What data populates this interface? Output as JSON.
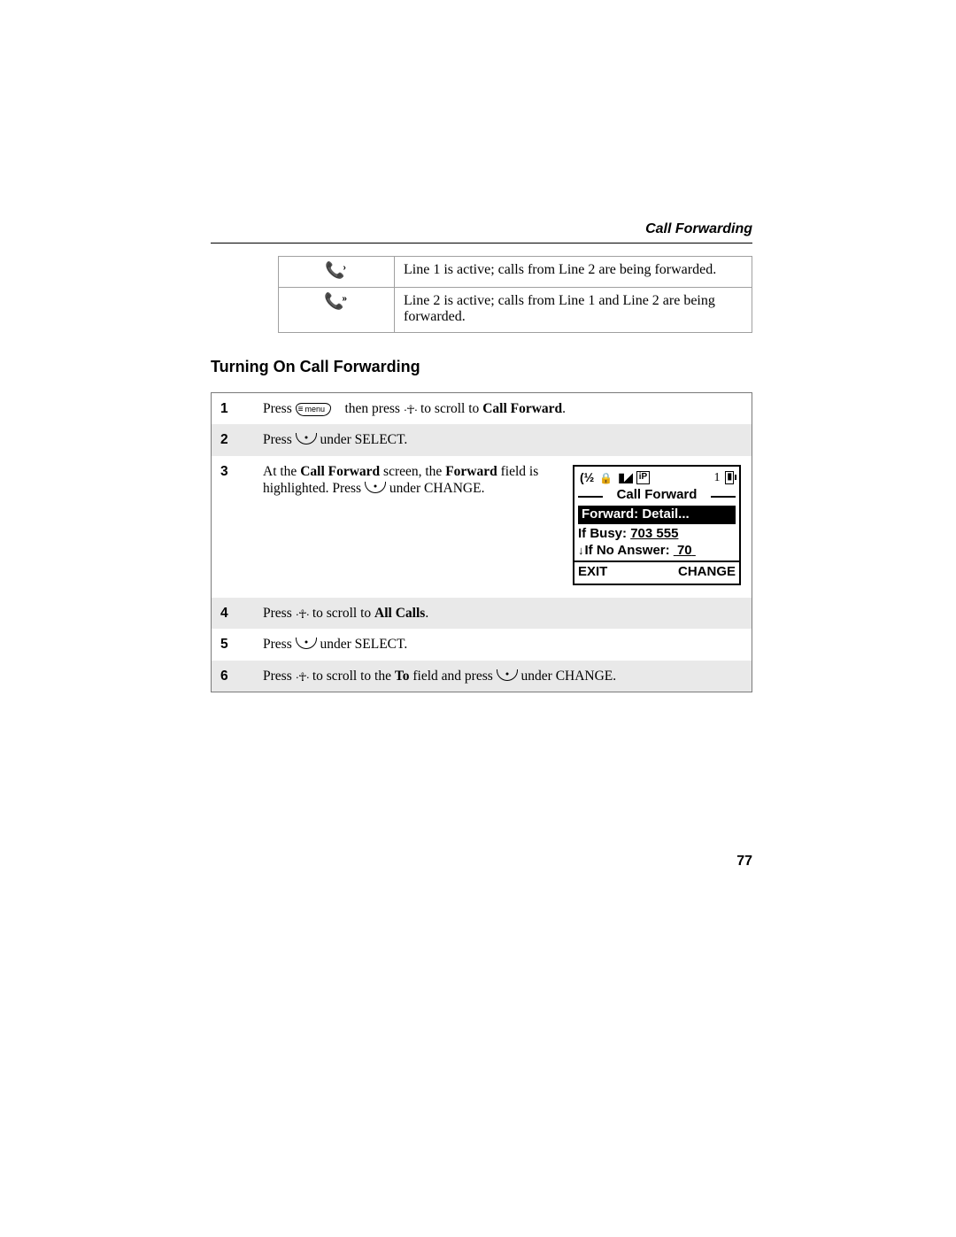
{
  "running_head": "Call Forwarding",
  "icon_table": {
    "rows": [
      {
        "icon_name": "phone-fwd-line1-icon",
        "desc": "Line 1 is active; calls from Line 2 are being forwarded."
      },
      {
        "icon_name": "phone-fwd-line2-icon",
        "desc": "Line 2 is active; calls from Line 1 and Line 2 are being forwarded."
      }
    ]
  },
  "section_heading": "Turning On Call Forwarding",
  "keys": {
    "menu_label": "menu"
  },
  "steps": [
    {
      "num": "1",
      "pre": "Press ",
      "mid": " then press ",
      "post": " to scroll to ",
      "bold": "Call Forward",
      "tail": "."
    },
    {
      "num": "2",
      "pre": "Press ",
      "post": " under SELECT."
    },
    {
      "num": "3",
      "pre": "At the ",
      "b1": "Call Forward",
      "mid1": " screen, the ",
      "b2": "Forward",
      "mid2": " field is highlighted. Press ",
      "post": " under CHANGE."
    },
    {
      "num": "4",
      "pre": "Press ",
      "post": " to scroll to ",
      "bold": "All Calls",
      "tail": "."
    },
    {
      "num": "5",
      "pre": "Press ",
      "post": " under SELECT."
    },
    {
      "num": "6",
      "pre": "Press ",
      "mid": " to scroll to the ",
      "bold": "To",
      "mid2": " field and press ",
      "post": " under CHANGE."
    }
  ],
  "handset_screen": {
    "ip_label": "iP",
    "indicator_1": "1",
    "title": "Call Forward",
    "highlight": "Forward: Detail...",
    "if_busy_label": "If Busy:",
    "if_busy_value": "703 555",
    "if_noanswer_label": "If No Answer:",
    "if_noanswer_value": "70",
    "softkey_left": "EXIT",
    "softkey_right": "CHANGE"
  },
  "page_number": "77"
}
